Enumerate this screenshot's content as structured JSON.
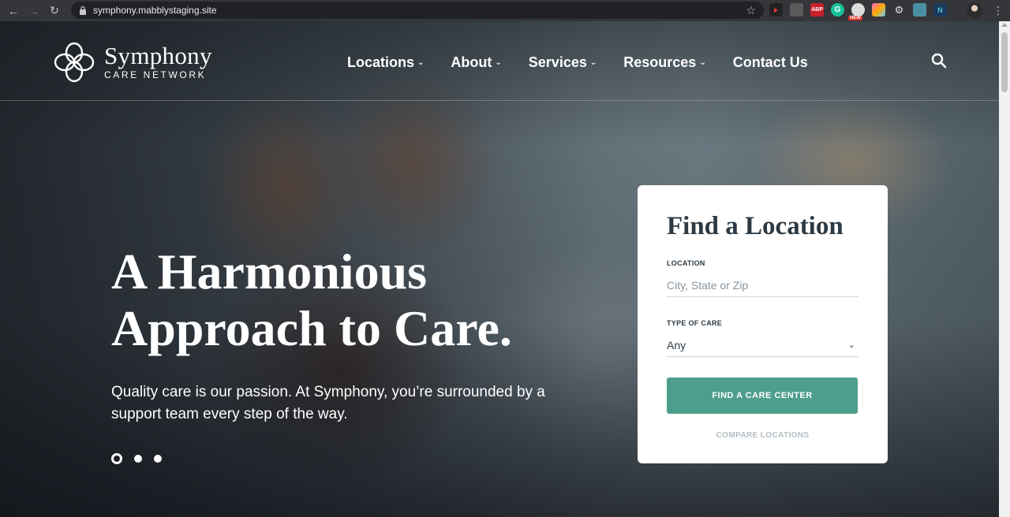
{
  "browser": {
    "url": "symphony.mabblystaging.site",
    "extensions": [
      "youtube-icon",
      "ext-icon",
      "abp-icon",
      "grammarly-icon",
      "new-badge-ext-icon",
      "colorful-ext-icon",
      "gear-ext-icon",
      "screenshot-ext-icon",
      "n-ext-icon"
    ],
    "new_badge": "NEW",
    "abp_label": "ABP",
    "grammarly_label": "G",
    "n_label": "N"
  },
  "site": {
    "brand_name": "Symphony",
    "brand_sub": "CARE NETWORK",
    "nav": [
      {
        "label": "Locations"
      },
      {
        "label": "About"
      },
      {
        "label": "Services"
      },
      {
        "label": "Resources"
      },
      {
        "label": "Contact Us"
      }
    ]
  },
  "hero": {
    "headline": "A Harmonious Approach to Care.",
    "subtext": "Quality care is our passion. At Symphony, you’re surrounded by a support team every step of the way.",
    "slides": 3,
    "active_slide": 1
  },
  "finder": {
    "title": "Find a Location",
    "location_label": "LOCATION",
    "location_placeholder": "City, State or Zip",
    "location_value": "",
    "type_label": "TYPE OF CARE",
    "type_value": "Any",
    "submit_label": "FIND A CARE CENTER",
    "compare_label": "COMPARE LOCATIONS"
  },
  "colors": {
    "accent": "#4e9e8e",
    "heading": "#2d3a44"
  }
}
